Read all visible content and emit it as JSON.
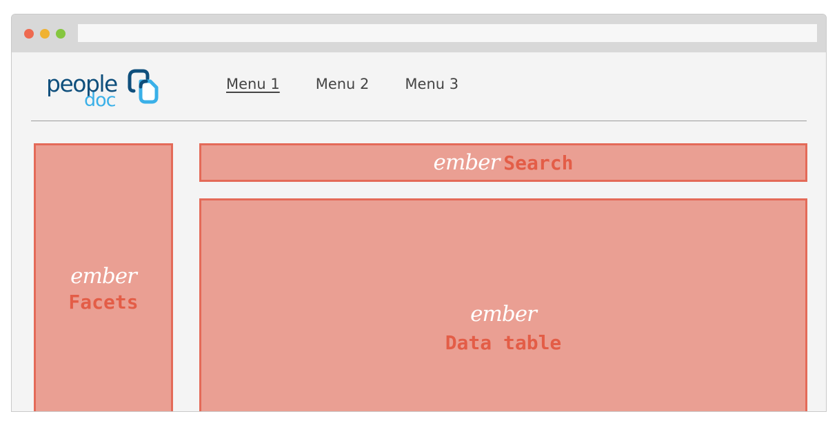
{
  "browser": {
    "buttons": [
      {
        "name": "close",
        "color": "#ee6a50"
      },
      {
        "name": "minimize",
        "color": "#f0b232"
      },
      {
        "name": "maximize",
        "color": "#85c63f"
      }
    ]
  },
  "logo": {
    "people": "people",
    "doc": "doc",
    "primary_color": "#0f4f7c",
    "secondary_color": "#3ab0e8"
  },
  "nav": {
    "items": [
      {
        "label": "Menu 1",
        "active": true
      },
      {
        "label": "Menu 2",
        "active": false
      },
      {
        "label": "Menu 3",
        "active": false
      }
    ]
  },
  "panels": {
    "facets": {
      "badge": "ember",
      "label": "Facets"
    },
    "search": {
      "badge": "ember",
      "label": "Search"
    },
    "table": {
      "badge": "ember",
      "label": "Data table"
    }
  },
  "colors": {
    "panel_fill": "#ea9f93",
    "panel_border": "#e46a58",
    "panel_label": "#e35d47"
  }
}
